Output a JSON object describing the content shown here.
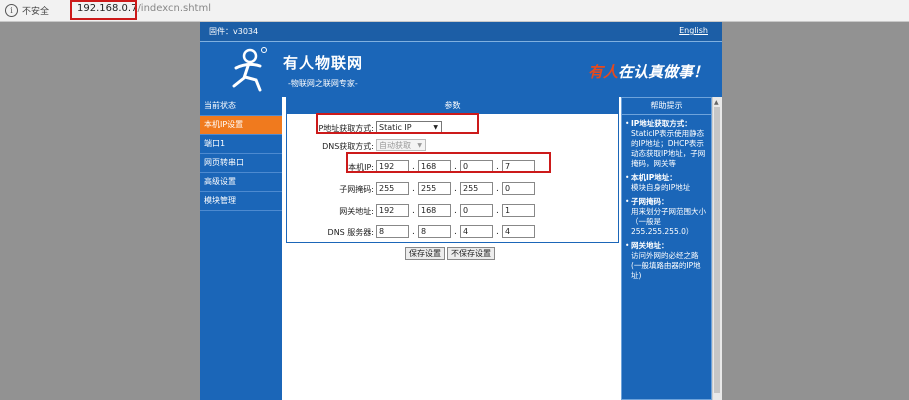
{
  "browser": {
    "info_icon": "i",
    "security_text": "不安全",
    "url_host": "192.168.0.7",
    "url_path": "/indexcn.shtml"
  },
  "header": {
    "firmware": "固件：v3034",
    "language_link": "English",
    "brand": "有人物联网",
    "brand_sub": "-物联网之联网专家-",
    "slogan_red": "有人",
    "slogan_white": "在认真做事！"
  },
  "nav": {
    "items": [
      {
        "label": "当前状态"
      },
      {
        "label": "本机IP设置"
      },
      {
        "label": "端口1"
      },
      {
        "label": "网页转串口"
      },
      {
        "label": "高级设置"
      },
      {
        "label": "模块管理"
      }
    ]
  },
  "params": {
    "title": "参数",
    "ip_mode_label": "IP地址获取方式:",
    "ip_mode_value": "Static IP",
    "dns_mode_label": "DNS获取方式:",
    "dns_mode_value": "自动获取",
    "local_ip_label": "本机IP:",
    "local_ip": [
      "192",
      "168",
      "0",
      "7"
    ],
    "subnet_label": "子网掩码:",
    "subnet": [
      "255",
      "255",
      "255",
      "0"
    ],
    "gateway_label": "网关地址:",
    "gateway": [
      "192",
      "168",
      "0",
      "1"
    ],
    "dns_label": "DNS 服务器:",
    "dns": [
      "8",
      "8",
      "4",
      "4"
    ],
    "save_button": "保存设置",
    "nosave_button": "不保存设置"
  },
  "help": {
    "title": "帮助提示",
    "items": [
      {
        "title": "IP地址获取方式：",
        "text": "StaticIP表示使用静态的IP地址；DHCP表示动态获取IP地址，子网掩码，网关等"
      },
      {
        "title": "本机IP地址：",
        "text": "模块自身的IP地址"
      },
      {
        "title": "子网掩码：",
        "text": "用来划分子网范围大小（一般是255.255.255.0）"
      },
      {
        "title": "网关地址：",
        "text": "访问外网的必经之路(一般填路由器的IP地址)"
      }
    ]
  },
  "colors": {
    "brand_blue": "#1b66b8",
    "nav_active": "#f07a1e",
    "highlight_red": "#cc1a1a"
  }
}
